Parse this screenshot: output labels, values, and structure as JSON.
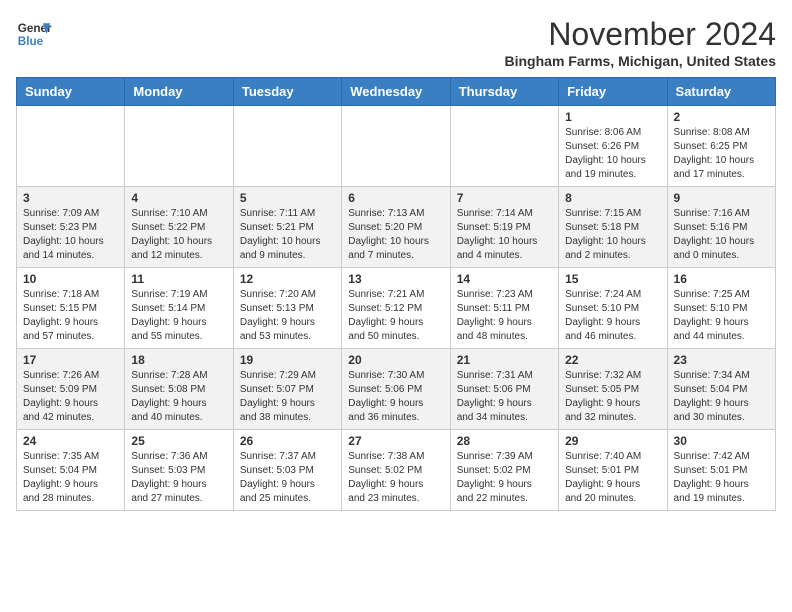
{
  "header": {
    "logo_line1": "General",
    "logo_line2": "Blue",
    "month": "November 2024",
    "location": "Bingham Farms, Michigan, United States"
  },
  "weekdays": [
    "Sunday",
    "Monday",
    "Tuesday",
    "Wednesday",
    "Thursday",
    "Friday",
    "Saturday"
  ],
  "weeks": [
    [
      {
        "day": "",
        "info": ""
      },
      {
        "day": "",
        "info": ""
      },
      {
        "day": "",
        "info": ""
      },
      {
        "day": "",
        "info": ""
      },
      {
        "day": "",
        "info": ""
      },
      {
        "day": "1",
        "info": "Sunrise: 8:06 AM\nSunset: 6:26 PM\nDaylight: 10 hours\nand 19 minutes."
      },
      {
        "day": "2",
        "info": "Sunrise: 8:08 AM\nSunset: 6:25 PM\nDaylight: 10 hours\nand 17 minutes."
      }
    ],
    [
      {
        "day": "3",
        "info": "Sunrise: 7:09 AM\nSunset: 5:23 PM\nDaylight: 10 hours\nand 14 minutes."
      },
      {
        "day": "4",
        "info": "Sunrise: 7:10 AM\nSunset: 5:22 PM\nDaylight: 10 hours\nand 12 minutes."
      },
      {
        "day": "5",
        "info": "Sunrise: 7:11 AM\nSunset: 5:21 PM\nDaylight: 10 hours\nand 9 minutes."
      },
      {
        "day": "6",
        "info": "Sunrise: 7:13 AM\nSunset: 5:20 PM\nDaylight: 10 hours\nand 7 minutes."
      },
      {
        "day": "7",
        "info": "Sunrise: 7:14 AM\nSunset: 5:19 PM\nDaylight: 10 hours\nand 4 minutes."
      },
      {
        "day": "8",
        "info": "Sunrise: 7:15 AM\nSunset: 5:18 PM\nDaylight: 10 hours\nand 2 minutes."
      },
      {
        "day": "9",
        "info": "Sunrise: 7:16 AM\nSunset: 5:16 PM\nDaylight: 10 hours\nand 0 minutes."
      }
    ],
    [
      {
        "day": "10",
        "info": "Sunrise: 7:18 AM\nSunset: 5:15 PM\nDaylight: 9 hours\nand 57 minutes."
      },
      {
        "day": "11",
        "info": "Sunrise: 7:19 AM\nSunset: 5:14 PM\nDaylight: 9 hours\nand 55 minutes."
      },
      {
        "day": "12",
        "info": "Sunrise: 7:20 AM\nSunset: 5:13 PM\nDaylight: 9 hours\nand 53 minutes."
      },
      {
        "day": "13",
        "info": "Sunrise: 7:21 AM\nSunset: 5:12 PM\nDaylight: 9 hours\nand 50 minutes."
      },
      {
        "day": "14",
        "info": "Sunrise: 7:23 AM\nSunset: 5:11 PM\nDaylight: 9 hours\nand 48 minutes."
      },
      {
        "day": "15",
        "info": "Sunrise: 7:24 AM\nSunset: 5:10 PM\nDaylight: 9 hours\nand 46 minutes."
      },
      {
        "day": "16",
        "info": "Sunrise: 7:25 AM\nSunset: 5:10 PM\nDaylight: 9 hours\nand 44 minutes."
      }
    ],
    [
      {
        "day": "17",
        "info": "Sunrise: 7:26 AM\nSunset: 5:09 PM\nDaylight: 9 hours\nand 42 minutes."
      },
      {
        "day": "18",
        "info": "Sunrise: 7:28 AM\nSunset: 5:08 PM\nDaylight: 9 hours\nand 40 minutes."
      },
      {
        "day": "19",
        "info": "Sunrise: 7:29 AM\nSunset: 5:07 PM\nDaylight: 9 hours\nand 38 minutes."
      },
      {
        "day": "20",
        "info": "Sunrise: 7:30 AM\nSunset: 5:06 PM\nDaylight: 9 hours\nand 36 minutes."
      },
      {
        "day": "21",
        "info": "Sunrise: 7:31 AM\nSunset: 5:06 PM\nDaylight: 9 hours\nand 34 minutes."
      },
      {
        "day": "22",
        "info": "Sunrise: 7:32 AM\nSunset: 5:05 PM\nDaylight: 9 hours\nand 32 minutes."
      },
      {
        "day": "23",
        "info": "Sunrise: 7:34 AM\nSunset: 5:04 PM\nDaylight: 9 hours\nand 30 minutes."
      }
    ],
    [
      {
        "day": "24",
        "info": "Sunrise: 7:35 AM\nSunset: 5:04 PM\nDaylight: 9 hours\nand 28 minutes."
      },
      {
        "day": "25",
        "info": "Sunrise: 7:36 AM\nSunset: 5:03 PM\nDaylight: 9 hours\nand 27 minutes."
      },
      {
        "day": "26",
        "info": "Sunrise: 7:37 AM\nSunset: 5:03 PM\nDaylight: 9 hours\nand 25 minutes."
      },
      {
        "day": "27",
        "info": "Sunrise: 7:38 AM\nSunset: 5:02 PM\nDaylight: 9 hours\nand 23 minutes."
      },
      {
        "day": "28",
        "info": "Sunrise: 7:39 AM\nSunset: 5:02 PM\nDaylight: 9 hours\nand 22 minutes."
      },
      {
        "day": "29",
        "info": "Sunrise: 7:40 AM\nSunset: 5:01 PM\nDaylight: 9 hours\nand 20 minutes."
      },
      {
        "day": "30",
        "info": "Sunrise: 7:42 AM\nSunset: 5:01 PM\nDaylight: 9 hours\nand 19 minutes."
      }
    ]
  ]
}
